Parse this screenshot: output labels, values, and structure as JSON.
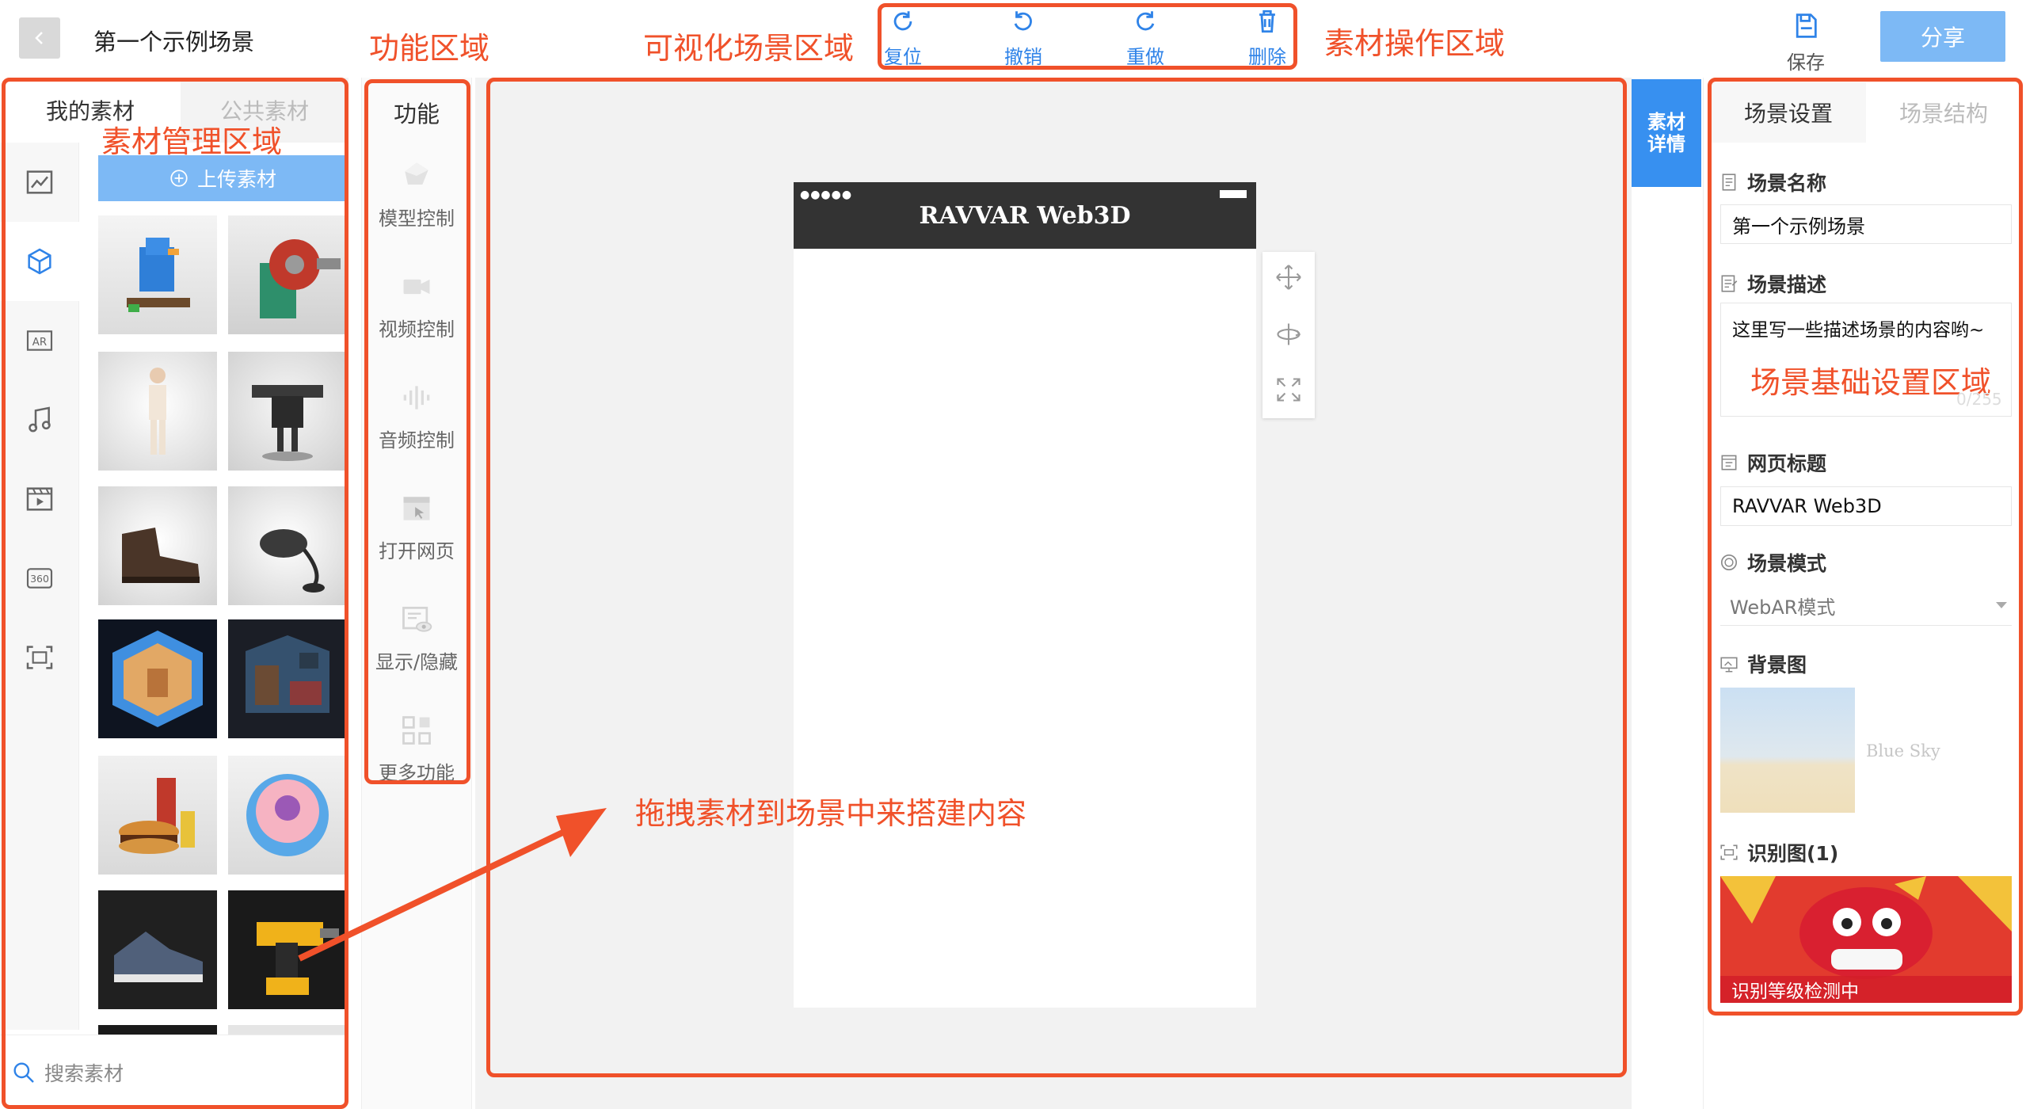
{
  "header": {
    "back_icon": "chevron-left-icon",
    "scene_title": "第一个示例场景",
    "save_label": "保存",
    "share_label": "分享"
  },
  "toolbar": {
    "reset_label": "复位",
    "undo_label": "撤销",
    "redo_label": "重做",
    "delete_label": "删除"
  },
  "annotations": {
    "function_area": "功能区域",
    "visual_scene_area": "可视化场景区域",
    "material_ops_area": "素材操作区域",
    "material_mgmt_area": "素材管理区域",
    "drag_hint": "拖拽素材到场景中来搭建内容",
    "scene_settings_area": "场景基础设置区域"
  },
  "materials": {
    "tab_mine": "我的素材",
    "tab_public": "公共素材",
    "upload_label": "上传素材",
    "search_placeholder": "搜索素材",
    "categories": [
      "chart-icon",
      "cube-icon",
      "ar-icon",
      "music-icon",
      "video-icon",
      "360-icon",
      "scan-icon"
    ]
  },
  "functions": {
    "title": "功能",
    "items": [
      {
        "label": "模型控制",
        "icon": "model-icon"
      },
      {
        "label": "视频控制",
        "icon": "video-camera-icon"
      },
      {
        "label": "音频控制",
        "icon": "audio-wave-icon"
      },
      {
        "label": "打开网页",
        "icon": "browser-icon"
      },
      {
        "label": "显示/隐藏",
        "icon": "eye-icon"
      },
      {
        "label": "更多功能",
        "icon": "grid-icon"
      }
    ]
  },
  "canvas": {
    "phone_title": "RAVVAR Web3D"
  },
  "detail_tab": {
    "label": "素材详情"
  },
  "settings": {
    "tab_settings": "场景设置",
    "tab_structure": "场景结构",
    "name_label": "场景名称",
    "name_value": "第一个示例场景",
    "desc_label": "场景描述",
    "desc_value": "这里写一些描述场景的内容哟~",
    "desc_count": "0/255",
    "webtitle_label": "网页标题",
    "webtitle_value": "RAVVAR Web3D",
    "mode_label": "场景模式",
    "mode_value": "WebAR模式",
    "bg_label": "背景图",
    "bg_name": "Blue Sky",
    "rec_label": "识别图(1)",
    "rec_status": "识别等级检测中"
  },
  "colors": {
    "accent": "#2f83e8",
    "button_blue": "#7db9f5",
    "annotation": "#f0512a"
  }
}
